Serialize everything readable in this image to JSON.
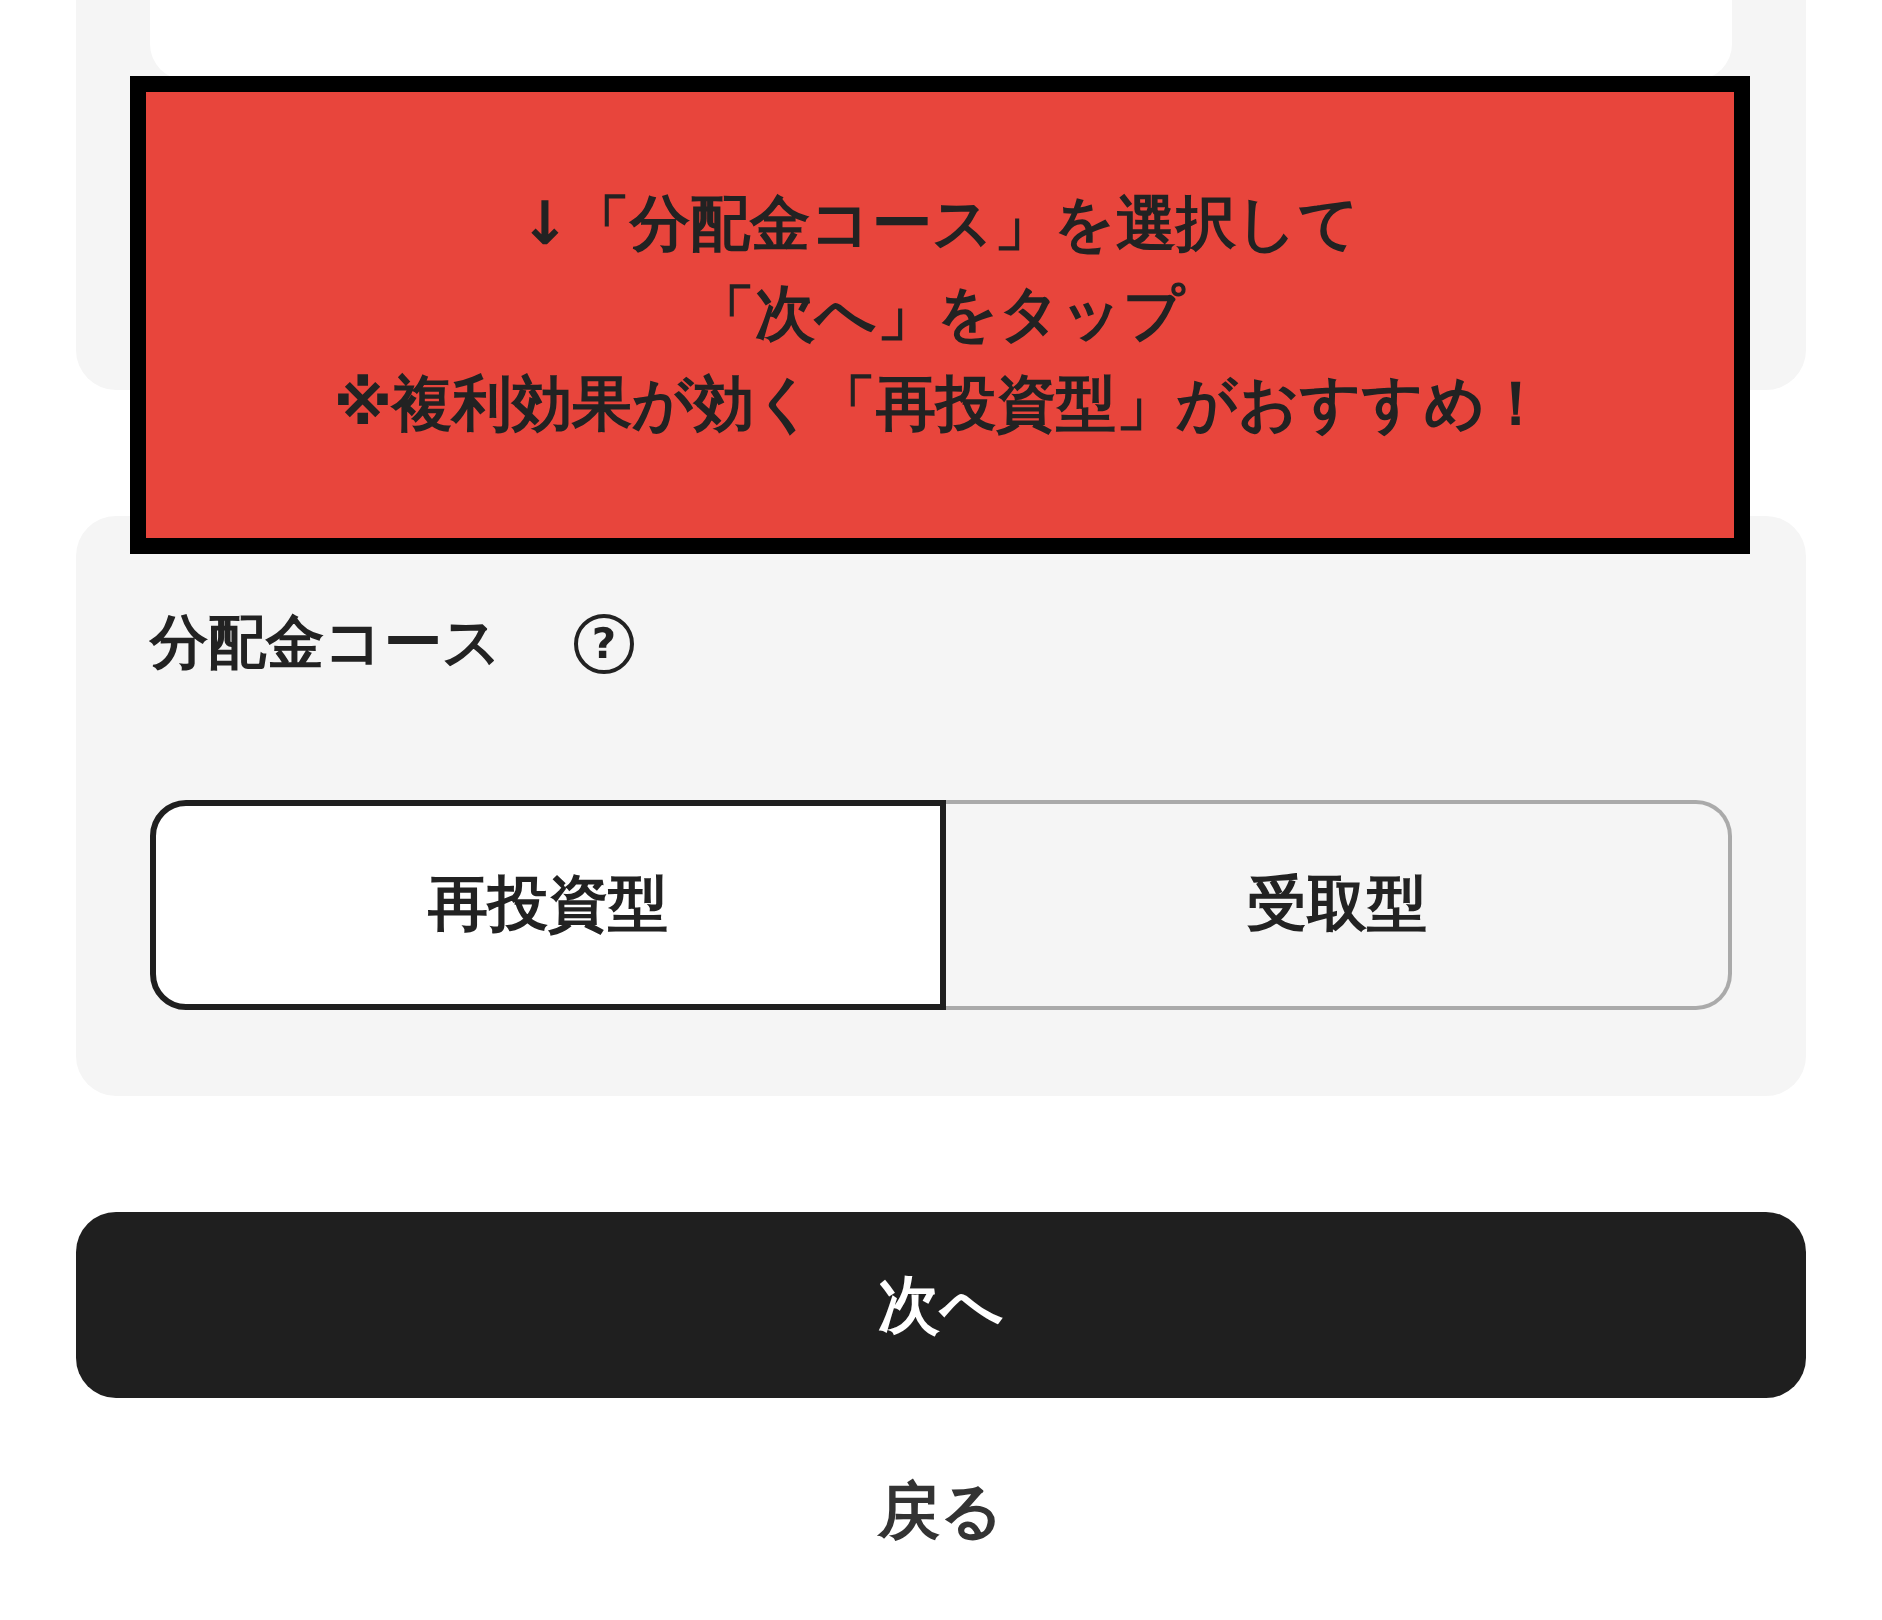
{
  "annotation": {
    "lines": [
      "↓「分配金コース」を選択して",
      "「次へ」をタップ",
      "※複利効果が効く「再投資型」がおすすめ！"
    ]
  },
  "distribution": {
    "label": "分配金コース",
    "help_icon": "?",
    "options": [
      {
        "label": "再投資型",
        "selected": true
      },
      {
        "label": "受取型",
        "selected": false
      }
    ]
  },
  "next_button": "次へ",
  "back_link": "戻る"
}
